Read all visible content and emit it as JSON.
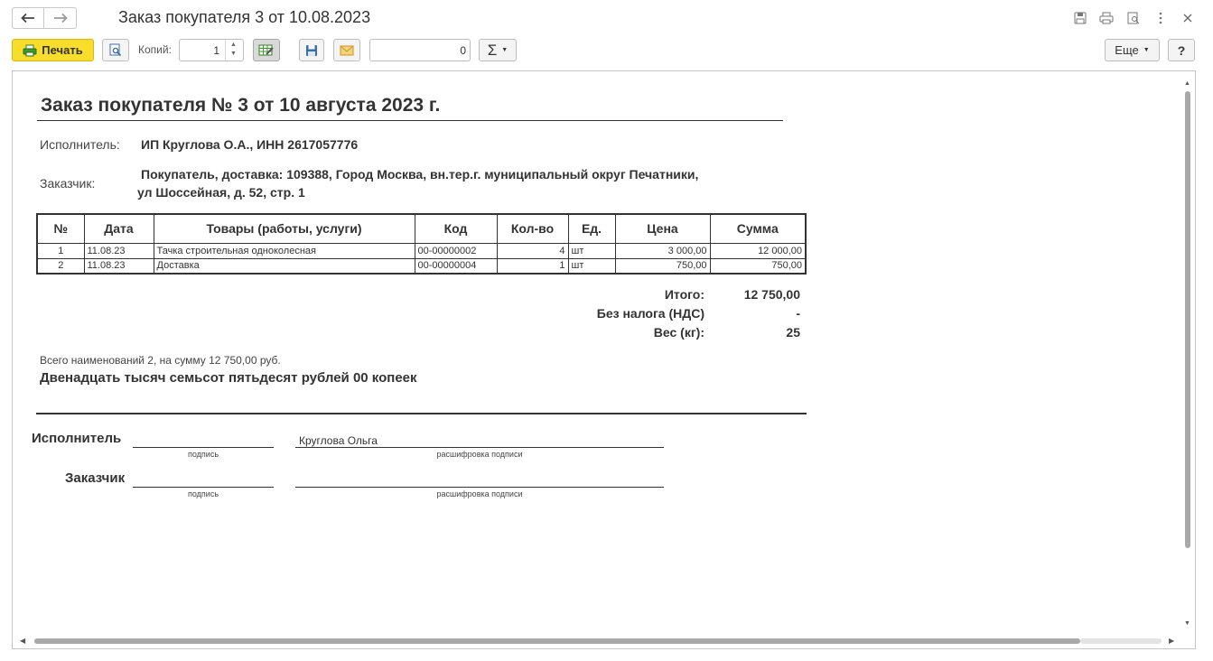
{
  "window": {
    "title": "Заказ покупателя 3 от 10.08.2023",
    "back_icon": "arrow-left-icon",
    "forward_icon": "arrow-right-icon"
  },
  "toolbar": {
    "print_label": "Печать",
    "copies_label": "Копий:",
    "copies_value": "1",
    "number_value": "0",
    "sum_label": "Σ",
    "more_label": "Еще",
    "help_label": "?",
    "accent_color": "#f9dd2b"
  },
  "document": {
    "title": "Заказ покупателя № 3 от 10 августа 2023 г.",
    "performer_label": "Исполнитель:",
    "performer_value": "ИП Круглова О.А.,  ИНН 2617057776",
    "customer_label": "Заказчик:",
    "customer_line1": "Покупатель,  доставка: 109388, Город Москва, вн.тер.г. муниципальный округ Печатники,",
    "customer_line2": "ул Шоссейная, д. 52, стр. 1",
    "table": {
      "headers": [
        "№",
        "Дата",
        "Товары (работы, услуги)",
        "Код",
        "Кол-во",
        "Ед.",
        "Цена",
        "Сумма"
      ],
      "rows": [
        [
          "1",
          "11.08.23",
          "Тачка строительная одноколесная",
          "00-00000002",
          "4",
          "шт",
          "3 000,00",
          "12 000,00"
        ],
        [
          "2",
          "11.08.23",
          "Доставка",
          "00-00000004",
          "1",
          "шт",
          "750,00",
          "750,00"
        ]
      ]
    },
    "totals": [
      {
        "label": "Итого:",
        "value": "12 750,00"
      },
      {
        "label": "Без налога (НДС)",
        "value": "-"
      },
      {
        "label": "Вес (кг):",
        "value": "25"
      }
    ],
    "summary_line": "Всего наименований 2, на сумму 12 750,00 руб.",
    "amount_in_words": "Двенадцать тысяч семьсот пятьдесят рублей 00 копеек",
    "signatures": {
      "performer_role": "Исполнитель",
      "performer_name": "Круглова Ольга",
      "customer_role": "Заказчик",
      "signature_caption": "подпись",
      "decoding_caption": "расшифровка подписи"
    }
  }
}
